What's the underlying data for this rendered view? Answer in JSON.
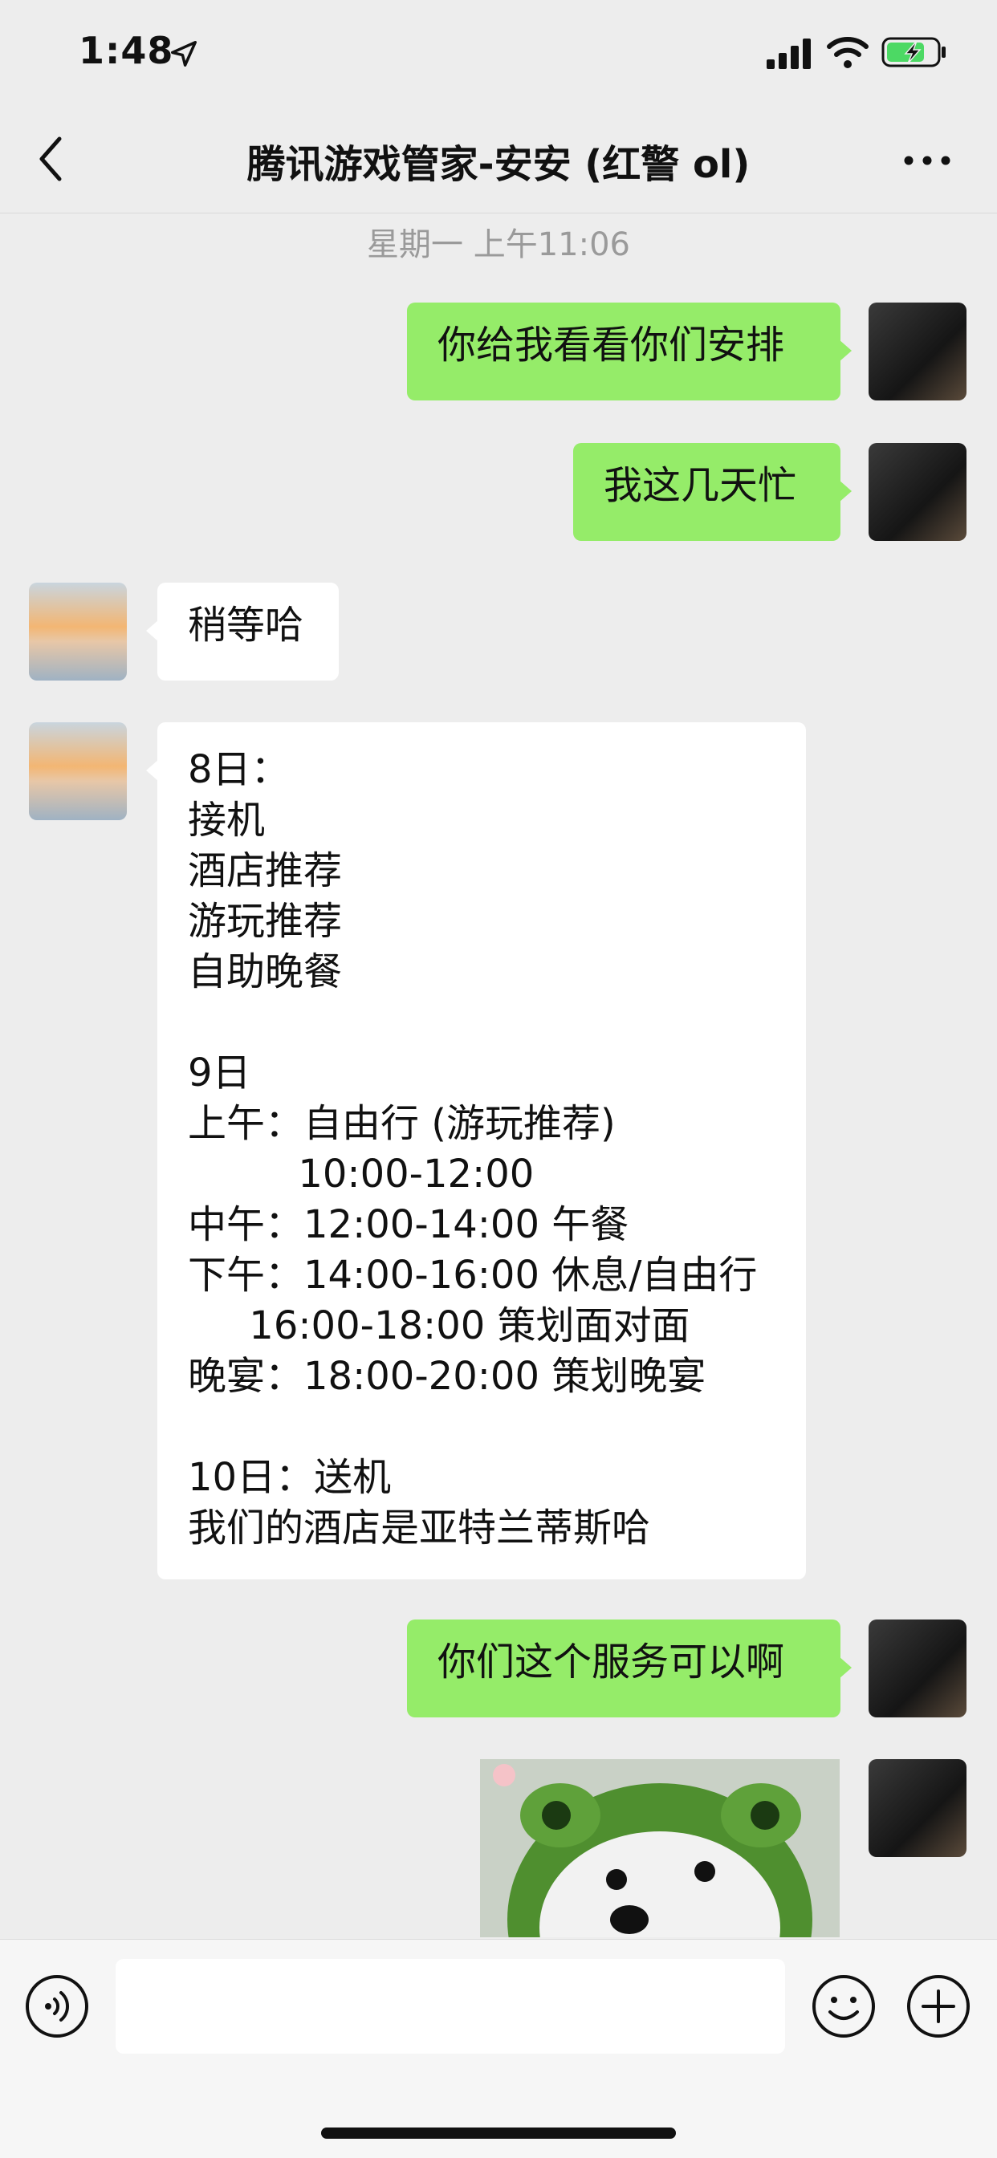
{
  "status_bar": {
    "time": "1:48",
    "icons": [
      "location-arrow-icon",
      "cellular-signal-icon",
      "wifi-icon",
      "battery-charging-icon"
    ],
    "battery_color": "#4cd964"
  },
  "header": {
    "title": "腾讯游戏管家-安安 (红警 ol)",
    "back_icon": "chevron-left-icon",
    "more_icon": "more-dots-icon"
  },
  "chat": {
    "timestamp": "星期一 上午11:06",
    "messages": [
      {
        "sender": "me",
        "text": "你给我看看你们安排"
      },
      {
        "sender": "me",
        "text": "我这几天忙"
      },
      {
        "sender": "them",
        "text": "稍等哈"
      },
      {
        "sender": "them",
        "text": "8日：\n接机\n酒店推荐\n游玩推荐\n自助晚餐\n\n9日\n上午：自由行 (游玩推荐)\n         10:00-12:00\n中午：12:00-14:00 午餐\n下午：14:00-16:00 休息/自由行\n     16:00-18:00 策划面对面\n晚宴：18:00-20:00 策划晚宴\n\n10日：送机\n我们的酒店是亚特兰蒂斯哈"
      },
      {
        "sender": "me",
        "text": "你们这个服务可以啊"
      },
      {
        "sender": "me",
        "type": "sticker",
        "text": ""
      }
    ]
  },
  "input_bar": {
    "voice_icon": "voice-icon",
    "emoji_icon": "emoji-icon",
    "plus_icon": "plus-icon",
    "value": ""
  },
  "colors": {
    "background": "#ededed",
    "my_bubble": "#95ec69",
    "their_bubble": "#ffffff",
    "timestamp_text": "#9a9a9a"
  }
}
